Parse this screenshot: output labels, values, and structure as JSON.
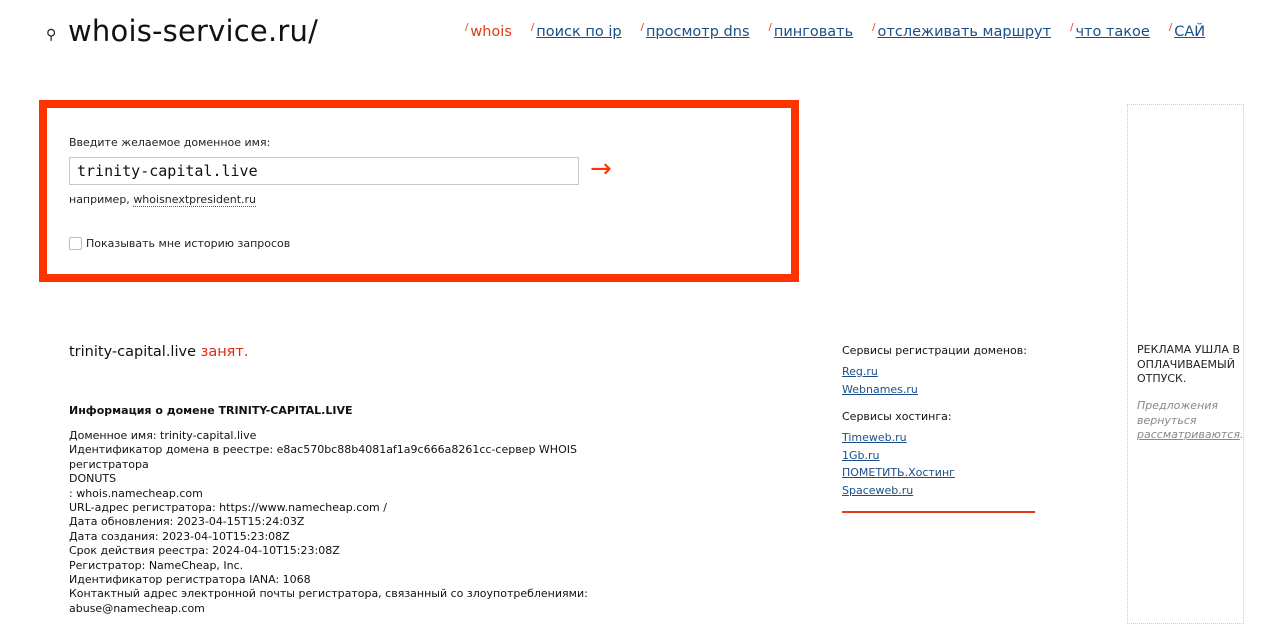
{
  "header": {
    "logo": "whois-service.ru/",
    "logo_icon": "search-icon",
    "nav": [
      {
        "label": "whois",
        "active": true
      },
      {
        "label": "поиск по ip",
        "active": false
      },
      {
        "label": "просмотр dns",
        "active": false
      },
      {
        "label": "пинговать",
        "active": false
      },
      {
        "label": "отслеживать маршрут",
        "active": false
      },
      {
        "label": "что такое",
        "active": false
      },
      {
        "label": "САЙ",
        "active": false
      }
    ]
  },
  "search": {
    "label": "Введите желаемое доменное имя:",
    "value": "trinity-capital.live",
    "go_icon": "arrow-right-icon",
    "example_prefix": "например,",
    "example_link": "whoisnextpresident.ru",
    "history_label": "Показывать мне историю запросов",
    "history_checked": false
  },
  "result": {
    "domain": "trinity-capital.live",
    "status": "занят."
  },
  "info": {
    "title": "Информация о домене TRINITY-CAPITAL.LIVE",
    "lines": [
      "Доменное имя: trinity-capital.live",
      "Идентификатор домена в реестре: e8ac570bc88b4081af1a9c666a8261cc-сервер WHOIS регистратора",
      "DONUTS",
      ": whois.namecheap.com",
      "URL-адрес регистратора: https://www.namecheap.com /",
      "Дата обновления: 2023-04-15T15:24:03Z",
      "Дата создания: 2023-04-10T15:23:08Z",
      "Срок действия реестра: 2024-04-10T15:23:08Z",
      "Регистратор: NameCheap, Inc.",
      "Идентификатор регистратора IANA: 1068",
      "Контактный адрес электронной почты регистратора, связанный со злоупотреблениями:",
      "abuse@namecheap.com"
    ]
  },
  "services": {
    "registration_title": "Сервисы регистрации доменов:",
    "registration_links": [
      "Reg.ru",
      "Webnames.ru"
    ],
    "hosting_title": "Сервисы хостинга:",
    "hosting_links": [
      "Timeweb.ru",
      "1Gb.ru",
      "ПОМЕТИТЬ.Хостинг",
      "Spaceweb.ru"
    ]
  },
  "ad": {
    "title": "РЕКЛАМА УШЛА В ОПЛАЧИВАЕМЫЙ ОТПУСК.",
    "note_prefix": "Предложения вернуться",
    "note_link": "рассматриваются",
    "note_suffix": "."
  },
  "colors": {
    "accent": "#ff3300",
    "link": "#1a4f8a",
    "busy": "#e02a10"
  }
}
